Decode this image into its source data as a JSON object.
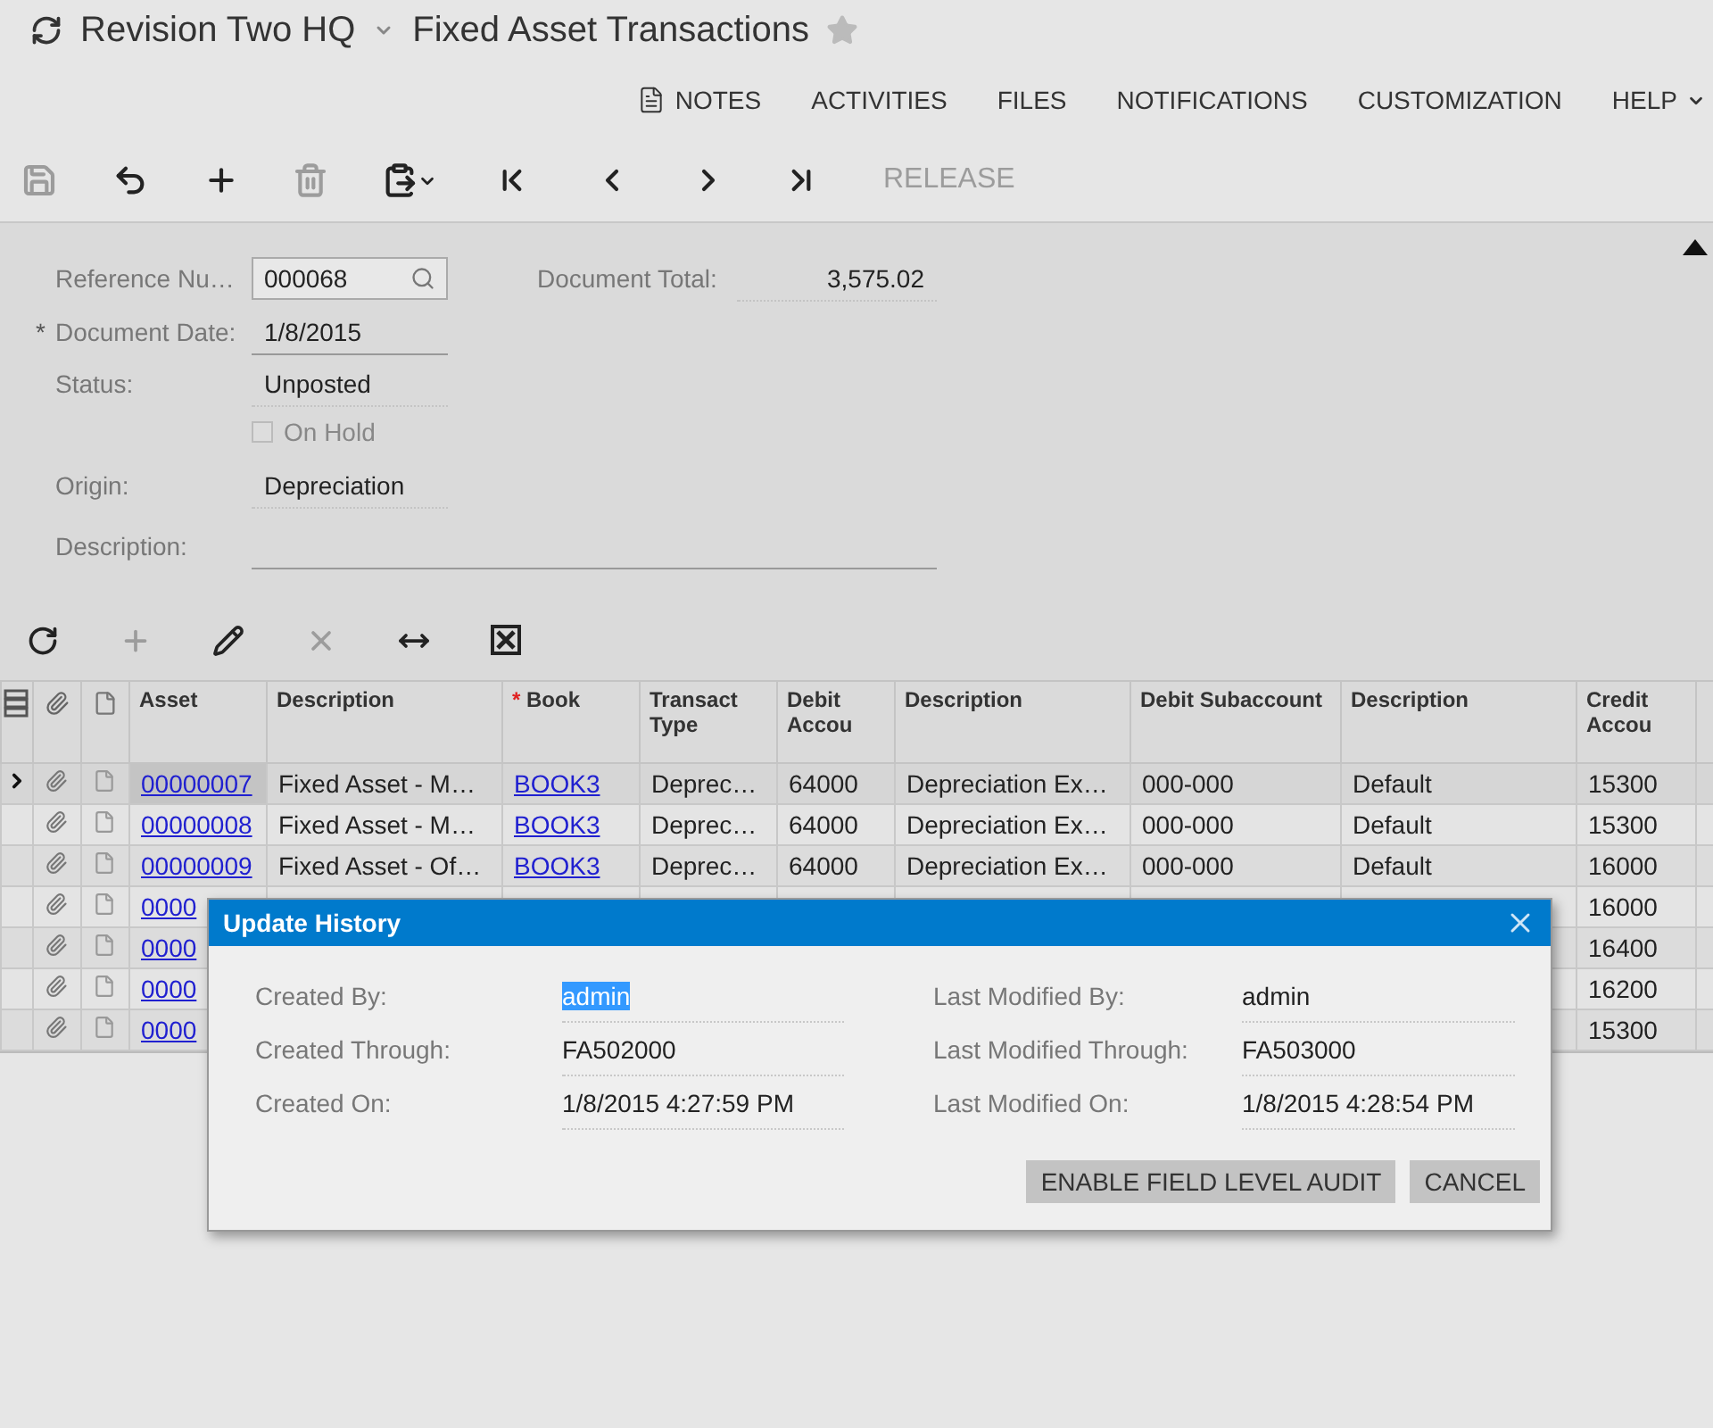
{
  "header": {
    "company": "Revision Two HQ",
    "screen": "Fixed Asset Transactions",
    "favorite": false
  },
  "top_menu": [
    {
      "label": "NOTES",
      "kind": "notes"
    },
    {
      "label": "ACTIVITIES",
      "kind": "plain"
    },
    {
      "label": "FILES",
      "kind": "plain"
    },
    {
      "label": "NOTIFICATIONS",
      "kind": "plain"
    },
    {
      "label": "CUSTOMIZATION",
      "kind": "plain"
    },
    {
      "label": "HELP",
      "kind": "dropdown"
    }
  ],
  "toolbar": [
    {
      "kind": "save",
      "disabled": true
    },
    {
      "kind": "undo",
      "disabled": false
    },
    {
      "kind": "add",
      "disabled": false
    },
    {
      "kind": "delete",
      "disabled": true
    },
    {
      "kind": "paste",
      "disabled": false
    },
    {
      "kind": "first",
      "disabled": false
    },
    {
      "kind": "previous",
      "disabled": false
    },
    {
      "kind": "next",
      "disabled": false
    },
    {
      "kind": "last",
      "disabled": false
    },
    {
      "kind": "text",
      "label": "RELEASE",
      "disabled": true
    }
  ],
  "form": {
    "reference": {
      "label": "Reference Nu…",
      "value": "000068"
    },
    "document_date": {
      "label": "Document Date:",
      "value": "1/8/2015",
      "required_mark": "*"
    },
    "status": {
      "label": "Status:",
      "value": "Unposted"
    },
    "on_hold": {
      "label": "On Hold",
      "checked": false,
      "disabled": true
    },
    "origin": {
      "label": "Origin:",
      "value": "Depreciation"
    },
    "description": {
      "label": "Description:"
    },
    "document_total": {
      "label": "Document Total:",
      "value": "3,575.02"
    }
  },
  "grid_toolbar": [
    {
      "kind": "refresh",
      "disabled": false
    },
    {
      "kind": "add",
      "disabled": true
    },
    {
      "kind": "edit",
      "disabled": false
    },
    {
      "kind": "delete",
      "disabled": true
    },
    {
      "kind": "fit",
      "disabled": false
    },
    {
      "kind": "excel",
      "disabled": false
    }
  ],
  "grid": {
    "columns": [
      {
        "label": "Asset",
        "kind": "link"
      },
      {
        "label": "Description",
        "kind": "text"
      },
      {
        "label": "Book",
        "kind": "link",
        "required_mark": "*"
      },
      {
        "label": "Transact Type",
        "kind": "text"
      },
      {
        "label": "Debit Accou",
        "kind": "text"
      },
      {
        "label": "Description",
        "kind": "text"
      },
      {
        "label": "Debit Subaccount",
        "kind": "text"
      },
      {
        "label": "Description",
        "kind": "text"
      },
      {
        "label": "Credit Accou",
        "kind": "text"
      }
    ],
    "rows": [
      {
        "selected": true,
        "cells": [
          "00000007",
          "Fixed Asset - M…",
          "BOOK3",
          "Deprec…",
          "64000",
          "Depreciation Ex…",
          "000-000",
          "Default",
          "15300"
        ]
      },
      {
        "selected": false,
        "cells": [
          "00000008",
          "Fixed Asset - M…",
          "BOOK3",
          "Deprec…",
          "64000",
          "Depreciation Ex…",
          "000-000",
          "Default",
          "15300"
        ]
      },
      {
        "selected": false,
        "cells": [
          "00000009",
          "Fixed Asset - Of…",
          "BOOK3",
          "Deprec…",
          "64000",
          "Depreciation Ex…",
          "000-000",
          "Default",
          "16000"
        ]
      },
      {
        "selected": false,
        "cells": [
          "0000",
          null,
          null,
          null,
          null,
          null,
          null,
          null,
          "16000"
        ]
      },
      {
        "selected": false,
        "cells": [
          "0000",
          null,
          null,
          null,
          null,
          null,
          null,
          null,
          "16400"
        ]
      },
      {
        "selected": false,
        "cells": [
          "0000",
          null,
          null,
          null,
          null,
          null,
          null,
          null,
          "16200"
        ]
      },
      {
        "selected": false,
        "cells": [
          "0000",
          null,
          null,
          null,
          null,
          null,
          null,
          null,
          "15300"
        ]
      }
    ]
  },
  "dialog": {
    "title": "Update History",
    "left": [
      {
        "label": "Created By:",
        "value": "admin",
        "selected": true
      },
      {
        "label": "Created Through:",
        "value": "FA502000",
        "selected": false
      },
      {
        "label": "Created On:",
        "value": "1/8/2015 4:27:59 PM",
        "selected": false
      }
    ],
    "right": [
      {
        "label": "Last Modified By:",
        "value": "admin",
        "selected": false
      },
      {
        "label": "Last Modified Through:",
        "value": "FA503000",
        "selected": false
      },
      {
        "label": "Last Modified On:",
        "value": "1/8/2015 4:28:54 PM",
        "selected": false
      }
    ],
    "buttons": [
      "ENABLE FIELD LEVEL AUDIT",
      "CANCEL"
    ]
  }
}
